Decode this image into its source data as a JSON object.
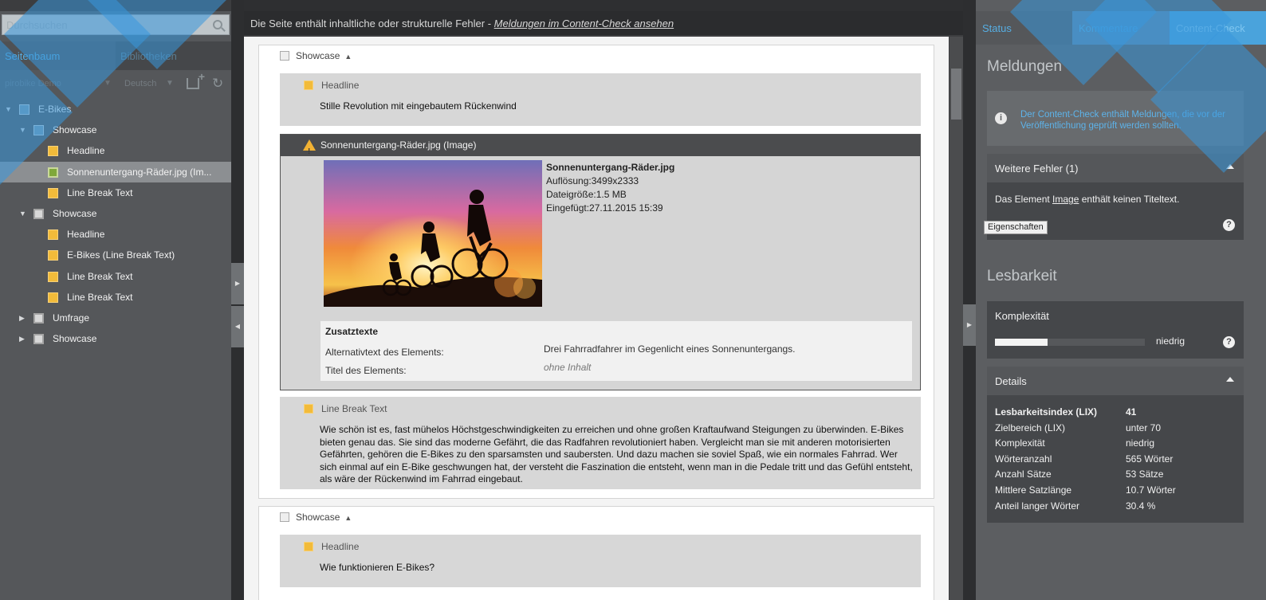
{
  "left": {
    "search_placeholder": "Durchsuchen",
    "tabs": [
      {
        "label": "Seitenbaum"
      },
      {
        "label": "Bibliotheken"
      }
    ],
    "project": "pirobike Demo",
    "language": "Deutsch",
    "tree": [
      {
        "label": "E-Bikes"
      },
      {
        "label": "Showcase"
      },
      {
        "label": "Headline"
      },
      {
        "label": "Sonnenuntergang-Räder.jpg (Im..."
      },
      {
        "label": "Line Break Text"
      },
      {
        "label": "Showcase"
      },
      {
        "label": "Headline"
      },
      {
        "label": "E-Bikes (Line Break Text)"
      },
      {
        "label": "Line Break Text"
      },
      {
        "label": "Line Break Text"
      },
      {
        "label": "Umfrage"
      },
      {
        "label": "Showcase"
      }
    ]
  },
  "center": {
    "banner_text": "Die Seite enthält inhaltliche oder strukturelle Fehler - ",
    "banner_link": "Meldungen im Content-Check ansehen",
    "showcase1": {
      "label": "Showcase",
      "headline_title": "Headline",
      "headline_text": "Stille Revolution mit eingebautem Rückenwind",
      "image": {
        "title": "Sonnenuntergang-Räder.jpg (Image)",
        "filename": "Sonnenuntergang-Räder.jpg",
        "resolution": "Auflösung:3499x2333",
        "filesize": "Dateigröße:1.5 MB",
        "inserted": "Eingefügt:27.11.2015 15:39",
        "zusatz_title": "Zusatztexte",
        "alt_label": "Alternativtext des Elements:",
        "alt_value": "Drei Fahrradfahrer im Gegenlicht eines Sonnenuntergangs.",
        "title_label": "Titel des Elements:",
        "title_value": "ohne Inhalt"
      },
      "lbt_title": "Line Break Text",
      "lbt_text": "Wie schön ist es, fast mühelos Höchstgeschwindigkeiten zu erreichen und ohne großen Kraftaufwand Steigungen zu überwinden.  E-Bikes bieten genau das. Sie sind das moderne Gefährt, die das Radfahren revolutioniert haben. Vergleicht man sie mit anderen motorisierten Gefährten, gehören die E-Bikes zu den sparsamsten und saubersten. Und dazu machen sie soviel Spaß, wie ein normales Fahrrad. Wer sich einmal auf ein E-Bike geschwungen hat, der versteht die Faszination die entsteht, wenn man in die Pedale tritt und das Gefühl entsteht, als wäre der Rückenwind im Fahrrad eingebaut."
    },
    "showcase2": {
      "label": "Showcase",
      "headline_title": "Headline",
      "headline_text": "Wie funktionieren E-Bikes?"
    }
  },
  "right": {
    "tabs": [
      {
        "label": "Status"
      },
      {
        "label": "Kommentare"
      },
      {
        "label": "Content-Check"
      }
    ],
    "meldungen_title": "Meldungen",
    "info_text": "Der Content-Check enthält Meldungen, die vor der Veröffentlichung geprüft werden sollten.",
    "weitere_title": "Weitere Fehler (1)",
    "weitere_pre": "Das Element ",
    "weitere_link": "Image",
    "weitere_post": " enthält keinen Titeltext.",
    "eigenschaften_button": "Eigenschaften",
    "lesbarkeit_title": "Lesbarkeit",
    "komplexitaet_title": "Komplexität",
    "komplexitaet_level": 0.35,
    "komplexitaet_value": "niedrig",
    "details_title": "Details",
    "details": [
      {
        "key": "Lesbarkeitsindex (LIX)",
        "value": "41"
      },
      {
        "key": "Zielbereich (LIX)",
        "value": "unter 70"
      },
      {
        "key": "Komplexität",
        "value": "niedrig"
      },
      {
        "key": "Wörteranzahl",
        "value": "565 Wörter"
      },
      {
        "key": "Anzahl Sätze",
        "value": "53 Sätze"
      },
      {
        "key": "Mittlere Satzlänge",
        "value": "10.7 Wörter"
      },
      {
        "key": "Anteil langer Wörter",
        "value": "30.4 %"
      }
    ]
  },
  "colors": {
    "accent_blue": "#4aa3dc",
    "warning": "#f2b233",
    "element_yellow": "#f2bb3a"
  }
}
